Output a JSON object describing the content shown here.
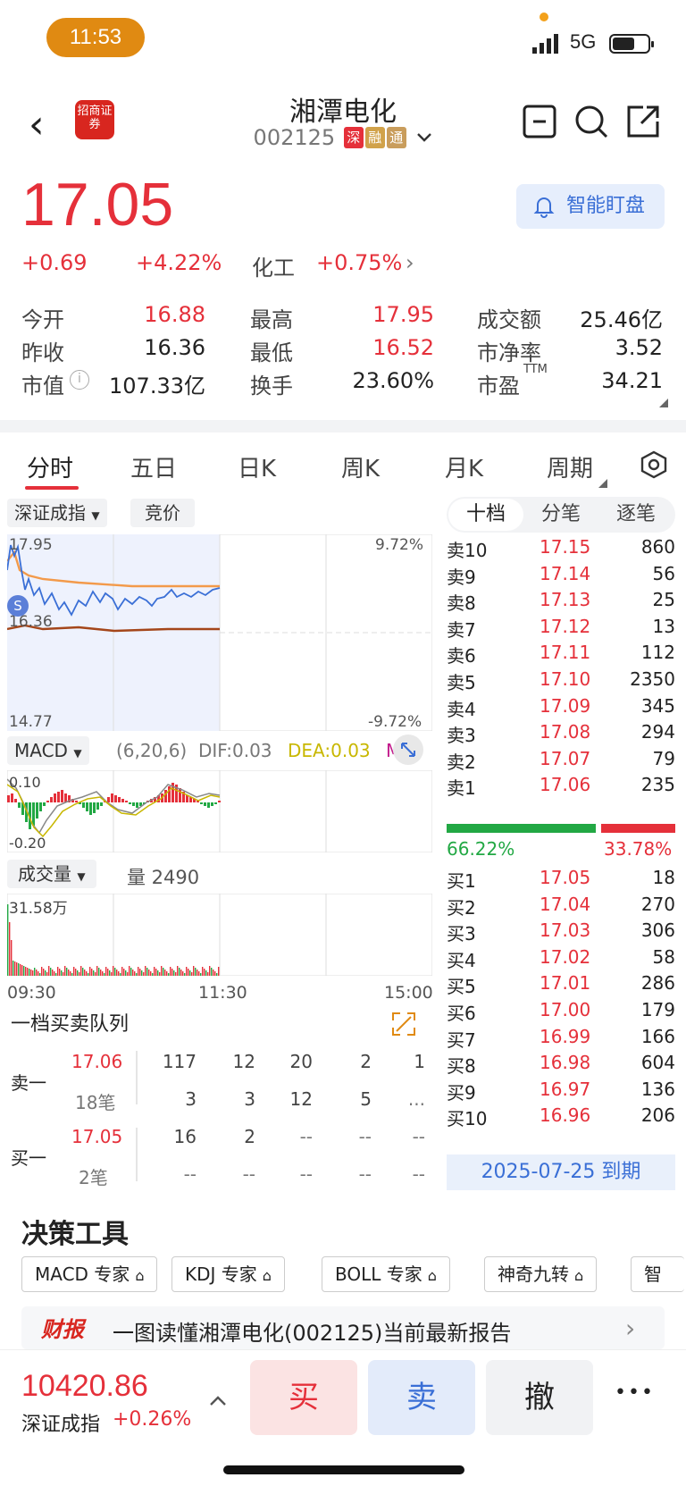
{
  "status": {
    "time": "11:53",
    "network": "5G"
  },
  "header": {
    "logo_text": "招商证券",
    "title": "湘潭电化",
    "code": "002125",
    "badges": [
      {
        "text": "深",
        "color": "#e5303a"
      },
      {
        "text": "融",
        "color": "#d1a24a"
      },
      {
        "text": "通",
        "color": "#c99d5c"
      }
    ]
  },
  "quote": {
    "price": "17.05",
    "change": "+0.69",
    "change_pct": "+4.22%",
    "sector": "化工",
    "sector_pct": "+0.75%",
    "smart_watch": "智能盯盘"
  },
  "stats": [
    {
      "k": "今开",
      "v": "16.88",
      "color": "red"
    },
    {
      "k": "最高",
      "v": "17.95",
      "color": "red"
    },
    {
      "k": "成交额",
      "v": "25.46亿",
      "color": "black"
    },
    {
      "k": "昨收",
      "v": "16.36",
      "color": "black"
    },
    {
      "k": "最低",
      "v": "16.52",
      "color": "red"
    },
    {
      "k": "市净率",
      "v": "3.52",
      "color": "black"
    },
    {
      "k": "市值",
      "v": "107.33亿",
      "color": "black"
    },
    {
      "k": "换手",
      "v": "23.60%",
      "color": "black"
    },
    {
      "k": "市盈",
      "v": "34.21",
      "color": "black",
      "sup": "TTM"
    }
  ],
  "tabs": [
    "分时",
    "五日",
    "日K",
    "周K",
    "月K",
    "周期"
  ],
  "chart": {
    "index_selector": "深证成指",
    "auction": "竞价",
    "price_high": "17.95",
    "price_mid": "16.36",
    "price_low": "14.77",
    "pct_high": "9.72%",
    "pct_low": "-9.72%",
    "macd_label": "MACD",
    "macd_params": "(6,20,6)",
    "dif": "DIF:0.03",
    "dea": "DEA:0.03",
    "macd_m": "M:",
    "macd_top": "0.10",
    "macd_bottom": "-0.20",
    "volume_label": "成交量",
    "volume_value": "量 2490",
    "volume_max": "31.58万",
    "time_start": "09:30",
    "time_mid": "11:30",
    "time_end": "15:00",
    "s_marker": "S"
  },
  "orderbook": {
    "tabs": [
      "十档",
      "分笔",
      "逐笔"
    ],
    "asks": [
      {
        "label": "卖10",
        "price": "17.15",
        "vol": "860"
      },
      {
        "label": "卖9",
        "price": "17.14",
        "vol": "56"
      },
      {
        "label": "卖8",
        "price": "17.13",
        "vol": "25"
      },
      {
        "label": "卖7",
        "price": "17.12",
        "vol": "13"
      },
      {
        "label": "卖6",
        "price": "17.11",
        "vol": "112"
      },
      {
        "label": "卖5",
        "price": "17.10",
        "vol": "2350"
      },
      {
        "label": "卖4",
        "price": "17.09",
        "vol": "345"
      },
      {
        "label": "卖3",
        "price": "17.08",
        "vol": "294"
      },
      {
        "label": "卖2",
        "price": "17.07",
        "vol": "79"
      },
      {
        "label": "卖1",
        "price": "17.06",
        "vol": "235"
      }
    ],
    "buy_ratio": "66.22%",
    "sell_ratio": "33.78%",
    "buy_ratio_value": 66.22,
    "bids": [
      {
        "label": "买1",
        "price": "17.05",
        "vol": "18"
      },
      {
        "label": "买2",
        "price": "17.04",
        "vol": "270"
      },
      {
        "label": "买3",
        "price": "17.03",
        "vol": "306"
      },
      {
        "label": "买4",
        "price": "17.02",
        "vol": "58"
      },
      {
        "label": "买5",
        "price": "17.01",
        "vol": "286"
      },
      {
        "label": "买6",
        "price": "17.00",
        "vol": "179"
      },
      {
        "label": "买7",
        "price": "16.99",
        "vol": "166"
      },
      {
        "label": "买8",
        "price": "16.98",
        "vol": "604"
      },
      {
        "label": "买9",
        "price": "16.97",
        "vol": "136"
      },
      {
        "label": "买10",
        "price": "16.96",
        "vol": "206"
      }
    ],
    "expiry": "2025-07-25 到期"
  },
  "queue": {
    "title": "一档买卖队列",
    "sell_label": "卖一",
    "sell_price": "17.06",
    "sell_count": "18笔",
    "sell_row1": [
      "117",
      "12",
      "20",
      "2",
      "1"
    ],
    "sell_row2": [
      "3",
      "3",
      "12",
      "5",
      "..."
    ],
    "buy_label": "买一",
    "buy_price": "17.05",
    "buy_count": "2笔",
    "buy_row1": [
      "16",
      "2",
      "--",
      "--",
      "--"
    ],
    "buy_row2": [
      "--",
      "--",
      "--",
      "--",
      "--"
    ]
  },
  "tools": {
    "title": "决策工具",
    "items": [
      "MACD 专家",
      "KDJ 专家",
      "BOLL 专家",
      "神奇九转",
      "智"
    ],
    "report_tag": "财报",
    "report_text": "一图读懂湘潭电化(002125)当前最新报告"
  },
  "bottom": {
    "index_value": "10420.86",
    "index_name": "深证成指",
    "index_pct": "+0.26%",
    "buy": "买",
    "sell": "卖",
    "cancel": "撤",
    "more": "•••"
  }
}
